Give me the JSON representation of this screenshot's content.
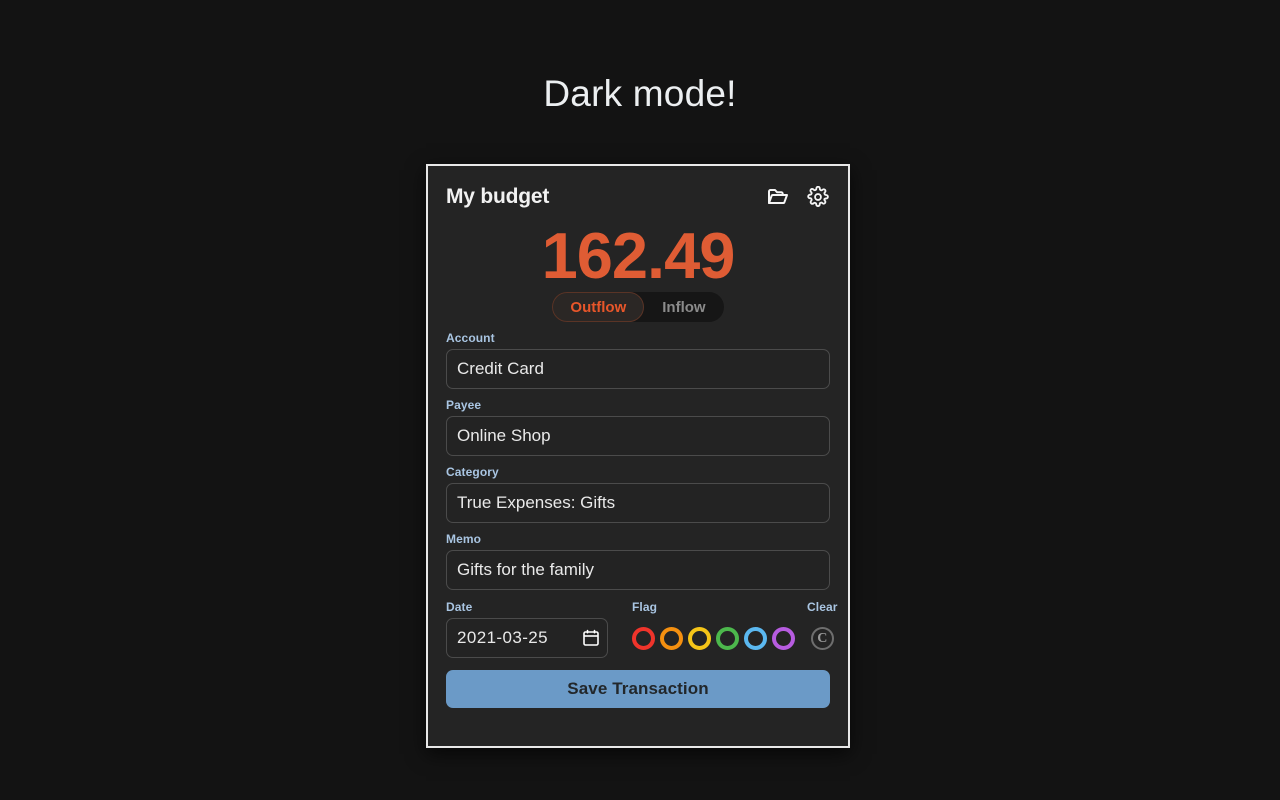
{
  "page": {
    "heading": "Dark mode!",
    "background_color": "#131313"
  },
  "card": {
    "title": "My budget",
    "border_color": "#e8e8e8",
    "background_color": "#242424",
    "header_icons": [
      {
        "name": "folder-icon",
        "label": "Open budget folder"
      },
      {
        "name": "gear-icon",
        "label": "Settings"
      }
    ],
    "amount": {
      "value": "162.49",
      "color": "#df5c34"
    },
    "direction_toggle": {
      "selected": "Outflow",
      "options": [
        {
          "label": "Outflow",
          "active": true
        },
        {
          "label": "Inflow",
          "active": false
        }
      ],
      "active_color": "#e8562a",
      "inactive_color": "#8b8b8b"
    },
    "fields": [
      {
        "label": "Account",
        "value": "Credit Card",
        "placeholder": "Account"
      },
      {
        "label": "Payee",
        "value": "Online Shop",
        "placeholder": "Payee"
      },
      {
        "label": "Category",
        "value": "True Expenses: Gifts",
        "placeholder": "Category"
      },
      {
        "label": "Memo",
        "value": "Gifts for the family",
        "placeholder": "Memo"
      }
    ],
    "date": {
      "label": "Date",
      "value": "2021-03-25",
      "icon": "calendar-icon"
    },
    "flag": {
      "label": "Flag",
      "colors": [
        {
          "name": "red",
          "hex": "#f0342b"
        },
        {
          "name": "orange",
          "hex": "#f59010"
        },
        {
          "name": "yellow",
          "hex": "#f5c518"
        },
        {
          "name": "green",
          "hex": "#4cb84c"
        },
        {
          "name": "blue",
          "hex": "#5bb8f0"
        },
        {
          "name": "purple",
          "hex": "#b75ce0"
        }
      ]
    },
    "clear": {
      "label": "Clear",
      "glyph": "C"
    },
    "save": {
      "label": "Save Transaction",
      "background_color": "#6b9ac7",
      "text_color": "#22272b"
    }
  }
}
